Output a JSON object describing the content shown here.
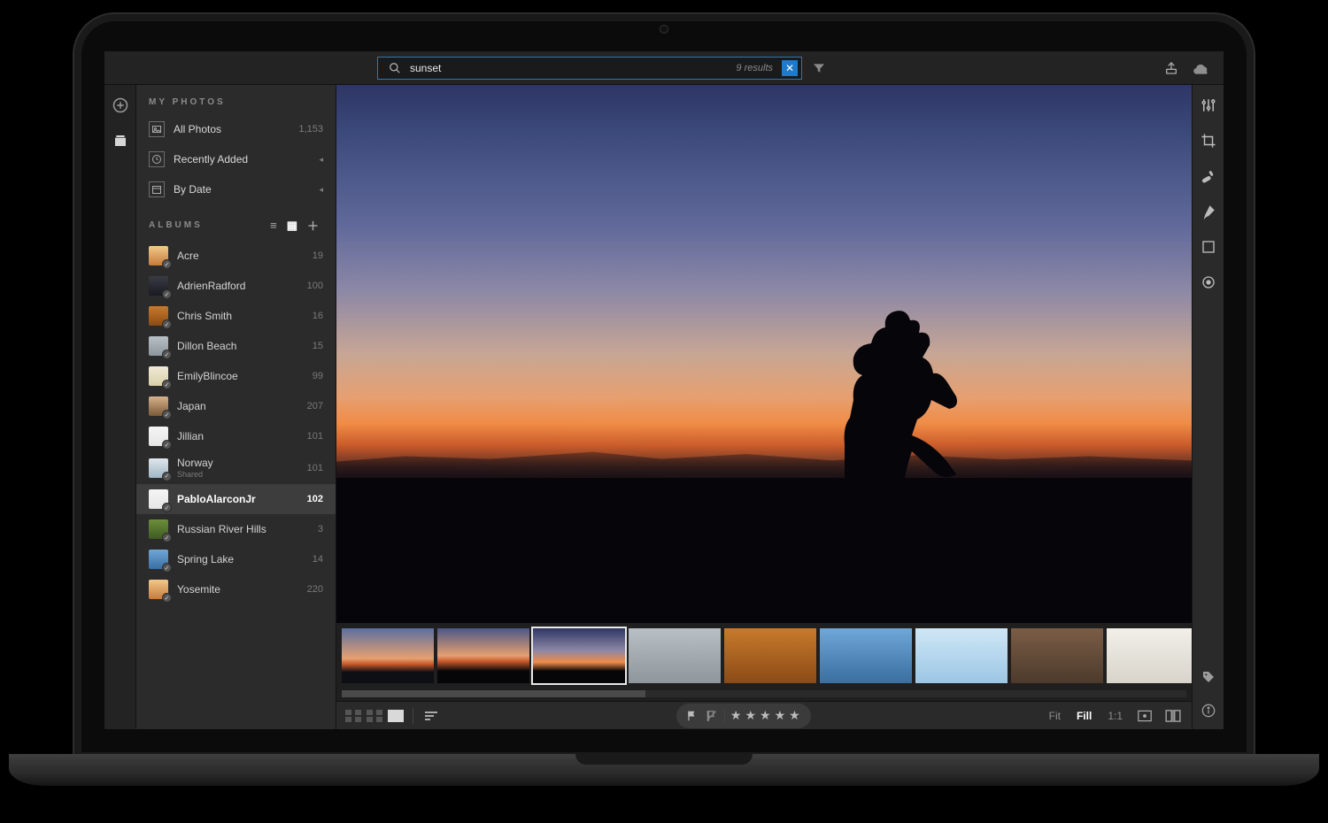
{
  "search": {
    "query": "sunset",
    "results_label": "9 results"
  },
  "sidebar": {
    "myphotos_header": "MY PHOTOS",
    "albums_header": "ALBUMS",
    "nav": [
      {
        "label": "All Photos",
        "meta": "1,153",
        "icon": "photo"
      },
      {
        "label": "Recently Added",
        "meta": "",
        "icon": "clock",
        "arrow": true
      },
      {
        "label": "By Date",
        "meta": "",
        "icon": "calendar",
        "arrow": true
      }
    ],
    "albums": [
      {
        "name": "Acre",
        "count": "19",
        "thumb": "g-warm"
      },
      {
        "name": "AdrienRadford",
        "count": "100",
        "thumb": "g-dark"
      },
      {
        "name": "Chris Smith",
        "count": "16",
        "thumb": "g-autumn"
      },
      {
        "name": "Dillon Beach",
        "count": "15",
        "thumb": "g-gray"
      },
      {
        "name": "EmilyBlincoe",
        "count": "99",
        "thumb": "g-light"
      },
      {
        "name": "Japan",
        "count": "207",
        "thumb": "g-japan"
      },
      {
        "name": "Jillian",
        "count": "101",
        "thumb": "g-white"
      },
      {
        "name": "Norway",
        "count": "101",
        "thumb": "g-norway",
        "sub": "Shared"
      },
      {
        "name": "PabloAlarconJr",
        "count": "102",
        "thumb": "g-white",
        "selected": true
      },
      {
        "name": "Russian River Hills",
        "count": "3",
        "thumb": "g-green"
      },
      {
        "name": "Spring Lake",
        "count": "14",
        "thumb": "g-blue"
      },
      {
        "name": "Yosemite",
        "count": "220",
        "thumb": "g-warm"
      }
    ]
  },
  "filmstrip": [
    {
      "thumb": "g-sunset1"
    },
    {
      "thumb": "g-sunset2"
    },
    {
      "thumb": "g-sunset3",
      "selected": true
    },
    {
      "thumb": "g-gray"
    },
    {
      "thumb": "g-autumn"
    },
    {
      "thumb": "g-blue"
    },
    {
      "thumb": "g-jump"
    },
    {
      "thumb": "g-rocks"
    },
    {
      "thumb": "g-beach"
    }
  ],
  "bottombar": {
    "stars": 5,
    "zoom": {
      "fit": "Fit",
      "fill": "Fill",
      "oneToOne": "1:1",
      "active": "fill"
    }
  }
}
